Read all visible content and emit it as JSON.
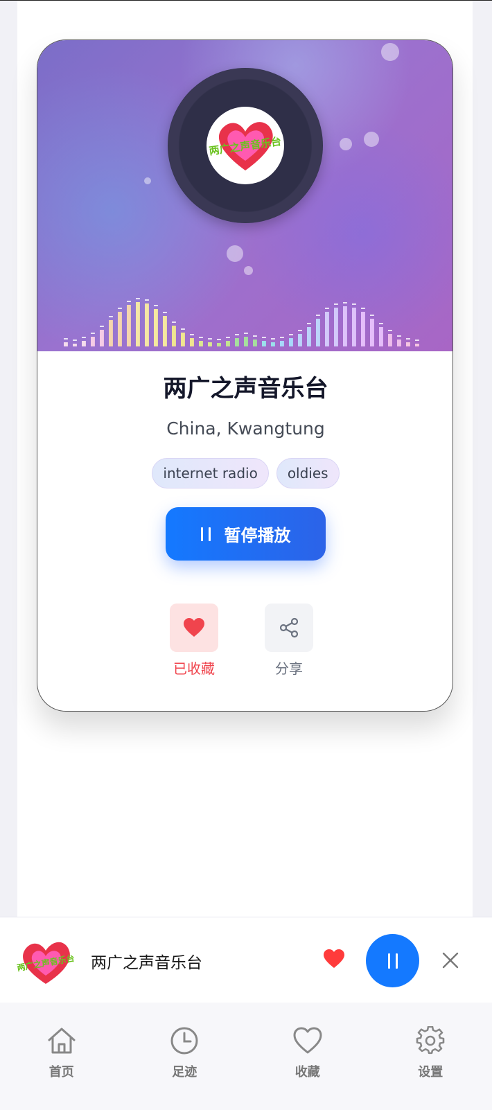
{
  "station": {
    "name": "两广之声音乐台",
    "location": "China, Kwangtung",
    "tags": [
      "internet radio",
      "oldies"
    ],
    "logo_text": "两广之声音乐台"
  },
  "player": {
    "pause_label": "暂停播放",
    "is_playing": true
  },
  "actions": {
    "favorite_label": "已收藏",
    "favorited": true,
    "share_label": "分享"
  },
  "mini_player": {
    "title": "两广之声音乐台"
  },
  "tabbar": {
    "items": [
      {
        "label": "首页",
        "icon": "home-icon"
      },
      {
        "label": "足迹",
        "icon": "clock-icon"
      },
      {
        "label": "收藏",
        "icon": "heart-icon"
      },
      {
        "label": "设置",
        "icon": "gear-icon"
      }
    ]
  },
  "colors": {
    "accent": "#1479ff",
    "favorite": "#f0444d",
    "title": "#14172a"
  }
}
